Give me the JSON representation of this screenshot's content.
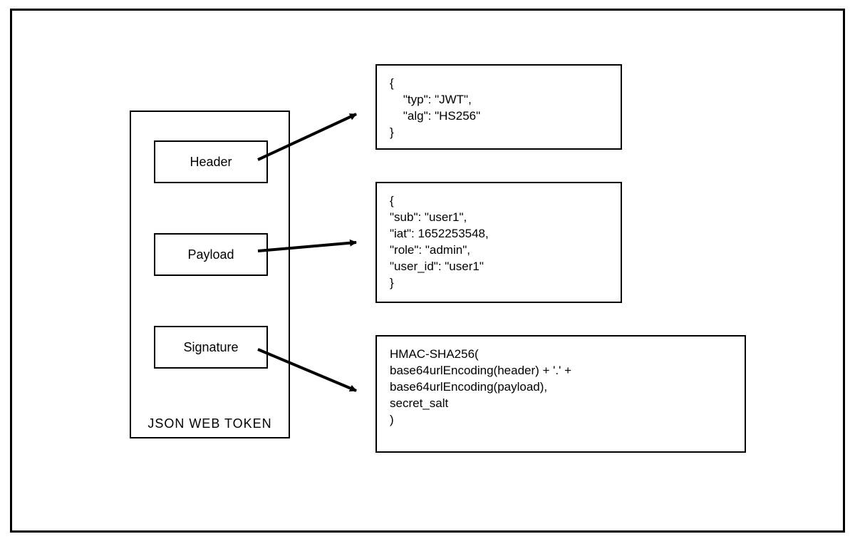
{
  "title": "JSON WEB TOKEN",
  "parts": {
    "header": "Header",
    "payload": "Payload",
    "signature": "Signature"
  },
  "blocks": {
    "header_json": "{\n    \"typ\": \"JWT\",\n    \"alg\": \"HS256\"\n}",
    "payload_json": "{\n\"sub\": \"user1\",\n\"iat\": 1652253548,\n\"role\": \"admin\",\n\"user_id\": \"user1\"\n}",
    "signature_text": "HMAC-SHA256(\nbase64urlEncoding(header) + '.' +\nbase64urlEncoding(payload),\nsecret_salt\n)"
  }
}
